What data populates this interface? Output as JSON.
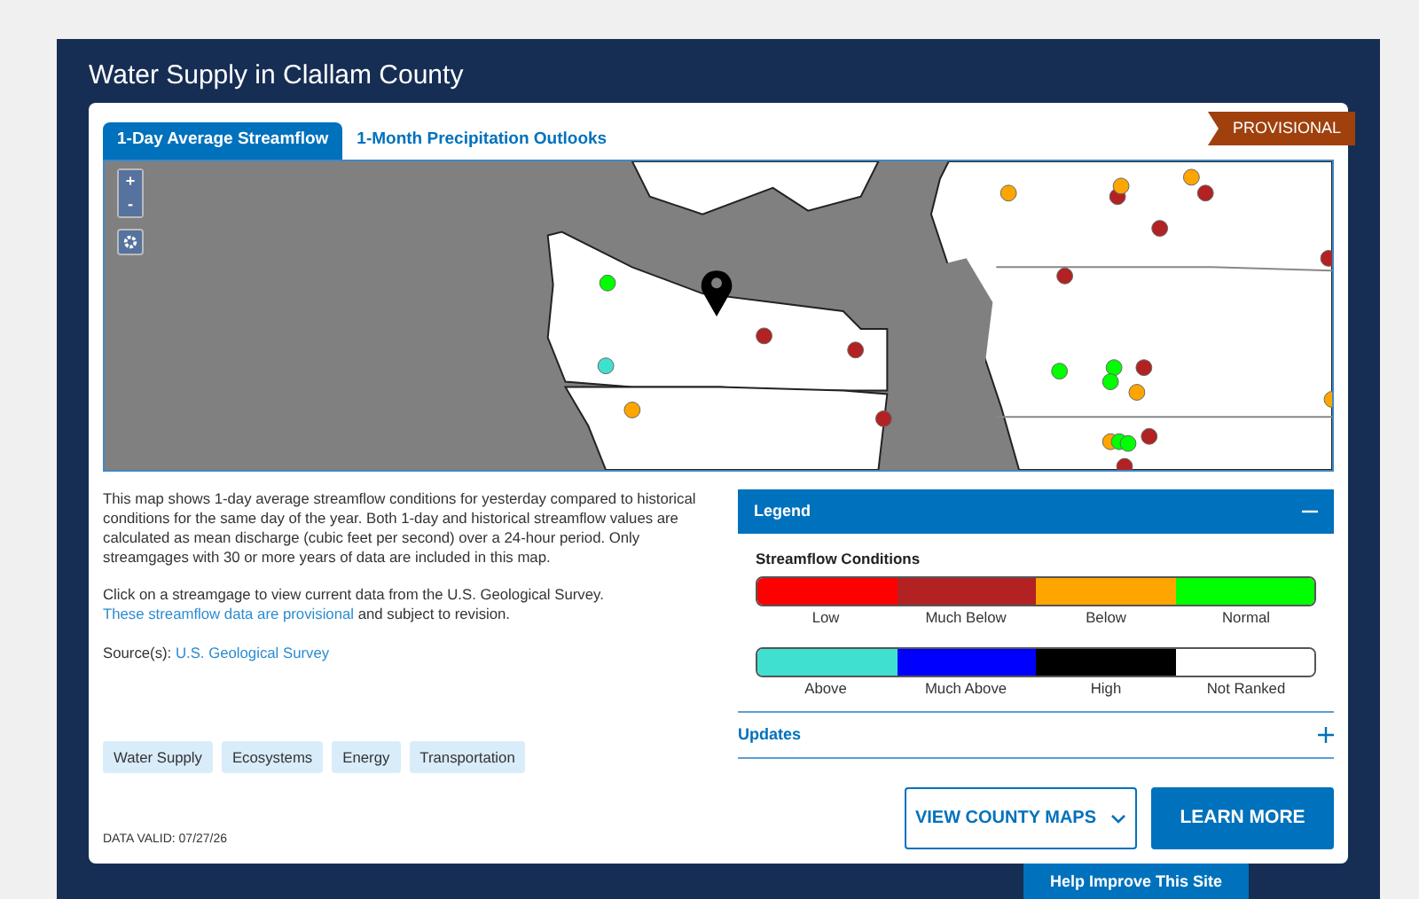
{
  "panel": {
    "title": "Water Supply in Clallam County"
  },
  "tabs": [
    {
      "label": "1-Day Average Streamflow",
      "selected": true
    },
    {
      "label": "1-Month Precipitation Outlooks",
      "selected": false
    }
  ],
  "badge": "PROVISIONAL",
  "map": {
    "zoom_in": "+",
    "zoom_out": "-"
  },
  "description": {
    "paragraph_1": "This map shows 1-day average streamflow conditions for yesterday compared to historical conditions for the same day of the year. Both 1-day and historical streamflow values are calculated as mean discharge (cubic feet per second) over a 24-hour period. Only streamgages with 30 or more years of data are included in this map.",
    "paragraph_2": "Click on a streamgage to view current data from the U.S. Geological Survey.",
    "paragraph_2_link": "These streamflow data are provisional",
    "paragraph_2_end": "and subject to revision.",
    "source_label": "Source(s):",
    "source_link": "U.S. Geological Survey"
  },
  "tags": [
    "Water Supply",
    "Ecosystems",
    "Energy",
    "Transportation"
  ],
  "data_valid": "DATA VALID: 07/27/26",
  "legend": {
    "title": "Legend",
    "expanded": true,
    "heading": "Streamflow Conditions",
    "rows": [
      [
        {
          "label": "Low",
          "color": "#ff0000"
        },
        {
          "label": "Much Below",
          "color": "#b22222"
        },
        {
          "label": "Below",
          "color": "#ffa500"
        },
        {
          "label": "Normal",
          "color": "#00ff00"
        }
      ],
      [
        {
          "label": "Above",
          "color": "#40e0d0"
        },
        {
          "label": "Much Above",
          "color": "#0000ff"
        },
        {
          "label": "High",
          "color": "#000000"
        },
        {
          "label": "Not Ranked",
          "color": "#ffffff"
        }
      ]
    ]
  },
  "updates": {
    "title": "Updates",
    "expanded": false
  },
  "buttons": {
    "county_maps": "VIEW COUNTY MAPS",
    "learn_more": "LEARN MORE"
  },
  "feedback": "Help Improve This Site"
}
